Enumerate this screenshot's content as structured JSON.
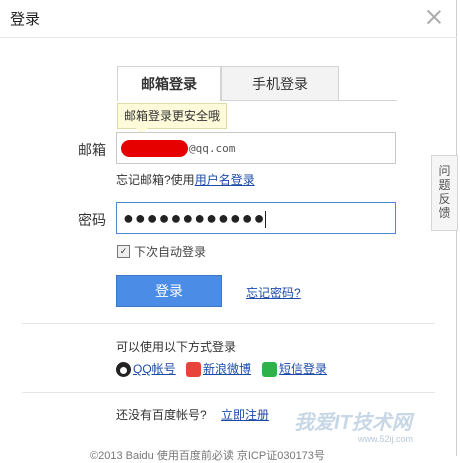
{
  "dialog": {
    "title": "登录"
  },
  "tabs": [
    {
      "label": "邮箱登录",
      "active": true
    },
    {
      "label": "手机登录",
      "active": false
    }
  ],
  "tooltip": "邮箱登录更安全哦",
  "email": {
    "label": "邮箱",
    "suffix": "@qq.com"
  },
  "forgot_email": {
    "text": "忘记邮箱?使用",
    "link": "用户名登录"
  },
  "password": {
    "label": "密码",
    "masked": "●●●●●●●●●●●●"
  },
  "remember": {
    "label": "下次自动登录",
    "checked": true,
    "mark": "✓"
  },
  "login_button": "登录",
  "forgot_password": "忘记密码?",
  "other_login": {
    "title": "可以使用以下方式登录",
    "options": [
      {
        "label": "QQ帐号",
        "icon": "qq-icon"
      },
      {
        "label": "新浪微博",
        "icon": "weibo-icon"
      },
      {
        "label": "短信登录",
        "icon": "sms-icon"
      }
    ]
  },
  "register": {
    "prompt": "还没有百度帐号?",
    "link": "立即注册"
  },
  "feedback": [
    "问",
    "题",
    "反",
    "馈"
  ],
  "footer": "©2013 Baidu 使用百度前必读 京ICP证030173号",
  "watermark": {
    "text": "我爱IT技术网",
    "url": "www.52ij.com"
  },
  "colors": {
    "accent": "#4b8ce6",
    "link": "#1b4aa8",
    "tooltip_bg": "#fdfbd9",
    "redaction": "#e60000"
  }
}
